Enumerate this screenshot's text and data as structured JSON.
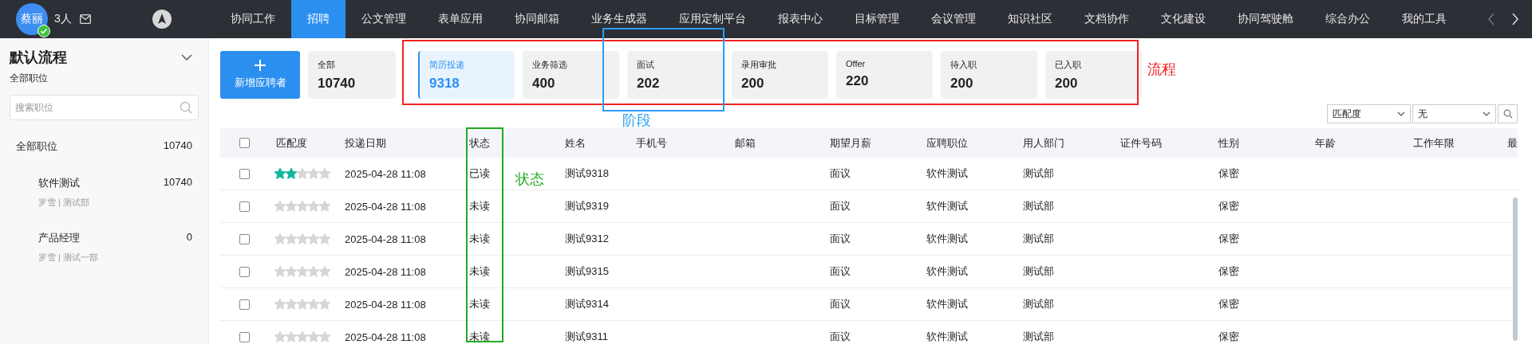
{
  "top_bar": {
    "avatar_text": "蔡丽",
    "online": true,
    "people_count": "3人",
    "nav": [
      {
        "label": "协同工作",
        "selected": false
      },
      {
        "label": "招聘",
        "selected": true
      },
      {
        "label": "公文管理",
        "selected": false
      },
      {
        "label": "表单应用",
        "selected": false
      },
      {
        "label": "协同邮箱",
        "selected": false
      },
      {
        "label": "业务生成器",
        "selected": false
      },
      {
        "label": "应用定制平台",
        "selected": false
      },
      {
        "label": "报表中心",
        "selected": false
      },
      {
        "label": "目标管理",
        "selected": false
      },
      {
        "label": "会议管理",
        "selected": false
      },
      {
        "label": "知识社区",
        "selected": false
      },
      {
        "label": "文档协作",
        "selected": false
      },
      {
        "label": "文化建设",
        "selected": false
      },
      {
        "label": "协同驾驶舱",
        "selected": false
      },
      {
        "label": "综合办公",
        "selected": false
      },
      {
        "label": "我的工具",
        "selected": false
      }
    ]
  },
  "sidebar": {
    "title": "默认流程",
    "subtitle": "全部职位",
    "search": {
      "placeholder": "搜索职位"
    },
    "items": [
      {
        "label": "全部职位",
        "count": "10740",
        "selected": false,
        "children": [
          {
            "label": "软件测试",
            "count": "10740",
            "meta": "罗雪 | 测试部",
            "selected": false
          },
          {
            "label": "产品经理",
            "count": "0",
            "meta": "罗雪 | 测试一部",
            "selected": false
          }
        ]
      }
    ]
  },
  "add_button": {
    "label": "新增应聘者"
  },
  "total": {
    "label": "全部",
    "count": "10740"
  },
  "stages": [
    {
      "label": "简历投递",
      "count": "9318",
      "selected": true
    },
    {
      "label": "业务筛选",
      "count": "400",
      "selected": false
    },
    {
      "label": "面试",
      "count": "202",
      "selected": false
    },
    {
      "label": "录用审批",
      "count": "200",
      "selected": false
    },
    {
      "label": "Offer",
      "count": "220",
      "selected": false
    },
    {
      "label": "待入职",
      "count": "200",
      "selected": false
    },
    {
      "label": "已入职",
      "count": "200",
      "selected": false
    }
  ],
  "sort": {
    "field": "匹配度",
    "order": "无"
  },
  "table": {
    "all_checked": false,
    "columns": [
      "匹配度",
      "投递日期",
      "状态",
      "姓名",
      "手机号",
      "邮箱",
      "期望月薪",
      "应聘职位",
      "用人部门",
      "证件号码",
      "性别",
      "年龄",
      "工作年限",
      "最"
    ],
    "rows": [
      {
        "checked": false,
        "stars": 2,
        "date": "2025-04-28 11:08",
        "status": "已读",
        "name": "测试9318",
        "salary": "面议",
        "position": "软件测试",
        "department": "测试部",
        "gender": "保密"
      },
      {
        "checked": false,
        "stars": 0,
        "date": "2025-04-28 11:08",
        "status": "未读",
        "name": "测试9319",
        "salary": "面议",
        "position": "软件测试",
        "department": "测试部",
        "gender": "保密"
      },
      {
        "checked": false,
        "stars": 0,
        "date": "2025-04-28 11:08",
        "status": "未读",
        "name": "测试9312",
        "salary": "面议",
        "position": "软件测试",
        "department": "测试部",
        "gender": "保密"
      },
      {
        "checked": false,
        "stars": 0,
        "date": "2025-04-28 11:08",
        "status": "未读",
        "name": "测试9315",
        "salary": "面议",
        "position": "软件测试",
        "department": "测试部",
        "gender": "保密"
      },
      {
        "checked": false,
        "stars": 0,
        "date": "2025-04-28 11:08",
        "status": "未读",
        "name": "测试9314",
        "salary": "面议",
        "position": "软件测试",
        "department": "测试部",
        "gender": "保密"
      },
      {
        "checked": false,
        "stars": 0,
        "date": "2025-04-28 11:08",
        "status": "未读",
        "name": "测试9311",
        "salary": "面议",
        "position": "软件测试",
        "department": "测试部",
        "gender": "保密"
      }
    ]
  },
  "annotations": [
    {
      "label": "流程",
      "color": "#ee2222"
    },
    {
      "label": "阶段",
      "color": "#2a9df4"
    },
    {
      "label": "状态",
      "color": "#22aa22"
    }
  ]
}
